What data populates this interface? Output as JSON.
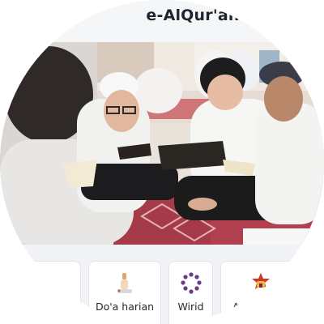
{
  "header": {
    "title": "e-AlQur'an"
  },
  "banner": {
    "photo_description_icon": "students-reading-quran-photo"
  },
  "menu": {
    "items": [
      {
        "label": "",
        "icon": "partial-card-icon"
      },
      {
        "label": "Do'a harian",
        "icon": "prayer-beads-hand-icon"
      },
      {
        "label": "Wirid",
        "icon": "tasbih-icon"
      },
      {
        "label": "A",
        "icon": "mosque-star-icon"
      }
    ]
  },
  "colors": {
    "carpet": "#b1404f",
    "title": "#1f2430",
    "card_border": "#e1e4ea"
  }
}
